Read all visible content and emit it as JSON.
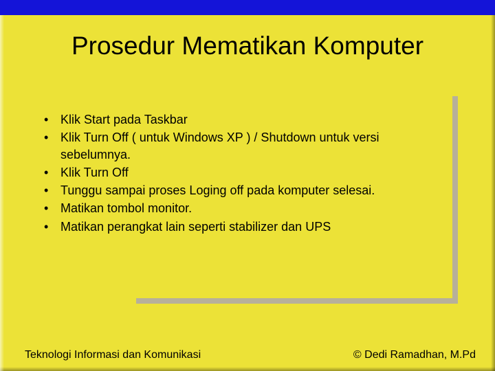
{
  "title": "Prosedur Mematikan Komputer",
  "bullets": [
    "Klik Start pada Taskbar",
    "Klik Turn Off ( untuk Windows XP ) / Shutdown untuk versi sebelumnya.",
    "Klik Turn Off",
    "Tunggu sampai proses Loging off pada komputer selesai.",
    "Matikan tombol monitor.",
    "Matikan perangkat lain seperti stabilizer dan UPS"
  ],
  "footer": {
    "left": "Teknologi Informasi dan Komunikasi",
    "right": "© Dedi Ramadhan, M.Pd"
  }
}
